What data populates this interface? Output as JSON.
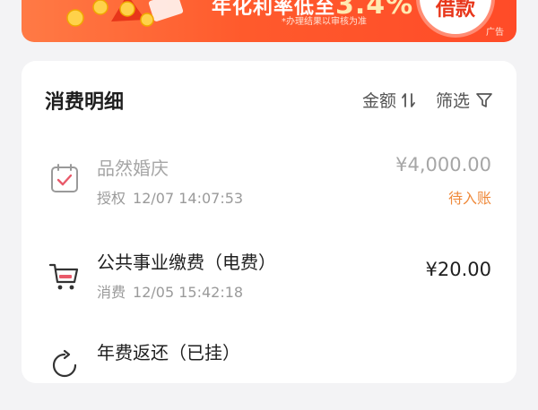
{
  "banner": {
    "headline": "年化利率低至",
    "rate": "3.4%",
    "subnote": "*办理结果以审核为准",
    "loan_button": "借款",
    "ad_tag": "广告"
  },
  "details": {
    "title": "消费明细",
    "sort_label": "金额",
    "filter_label": "筛选"
  },
  "transactions": [
    {
      "name": "品然婚庆",
      "kind": "授权",
      "datetime": "12/07 14:07:53",
      "amount": "¥4,000.00",
      "status": "待入账",
      "icon": "authorization-check-icon"
    },
    {
      "name": "公共事业缴费（电费）",
      "kind": "消费",
      "datetime": "12/05 15:42:18",
      "amount": "¥20.00",
      "icon": "shopping-cart-icon"
    },
    {
      "name": "年费返还（已挂）",
      "icon": "refund-icon"
    }
  ],
  "colors": {
    "banner_start": "#ff7a45",
    "banner_end": "#ff4b28",
    "pending_status": "#ef8a3c",
    "icon_accent": "#e95a6a"
  }
}
